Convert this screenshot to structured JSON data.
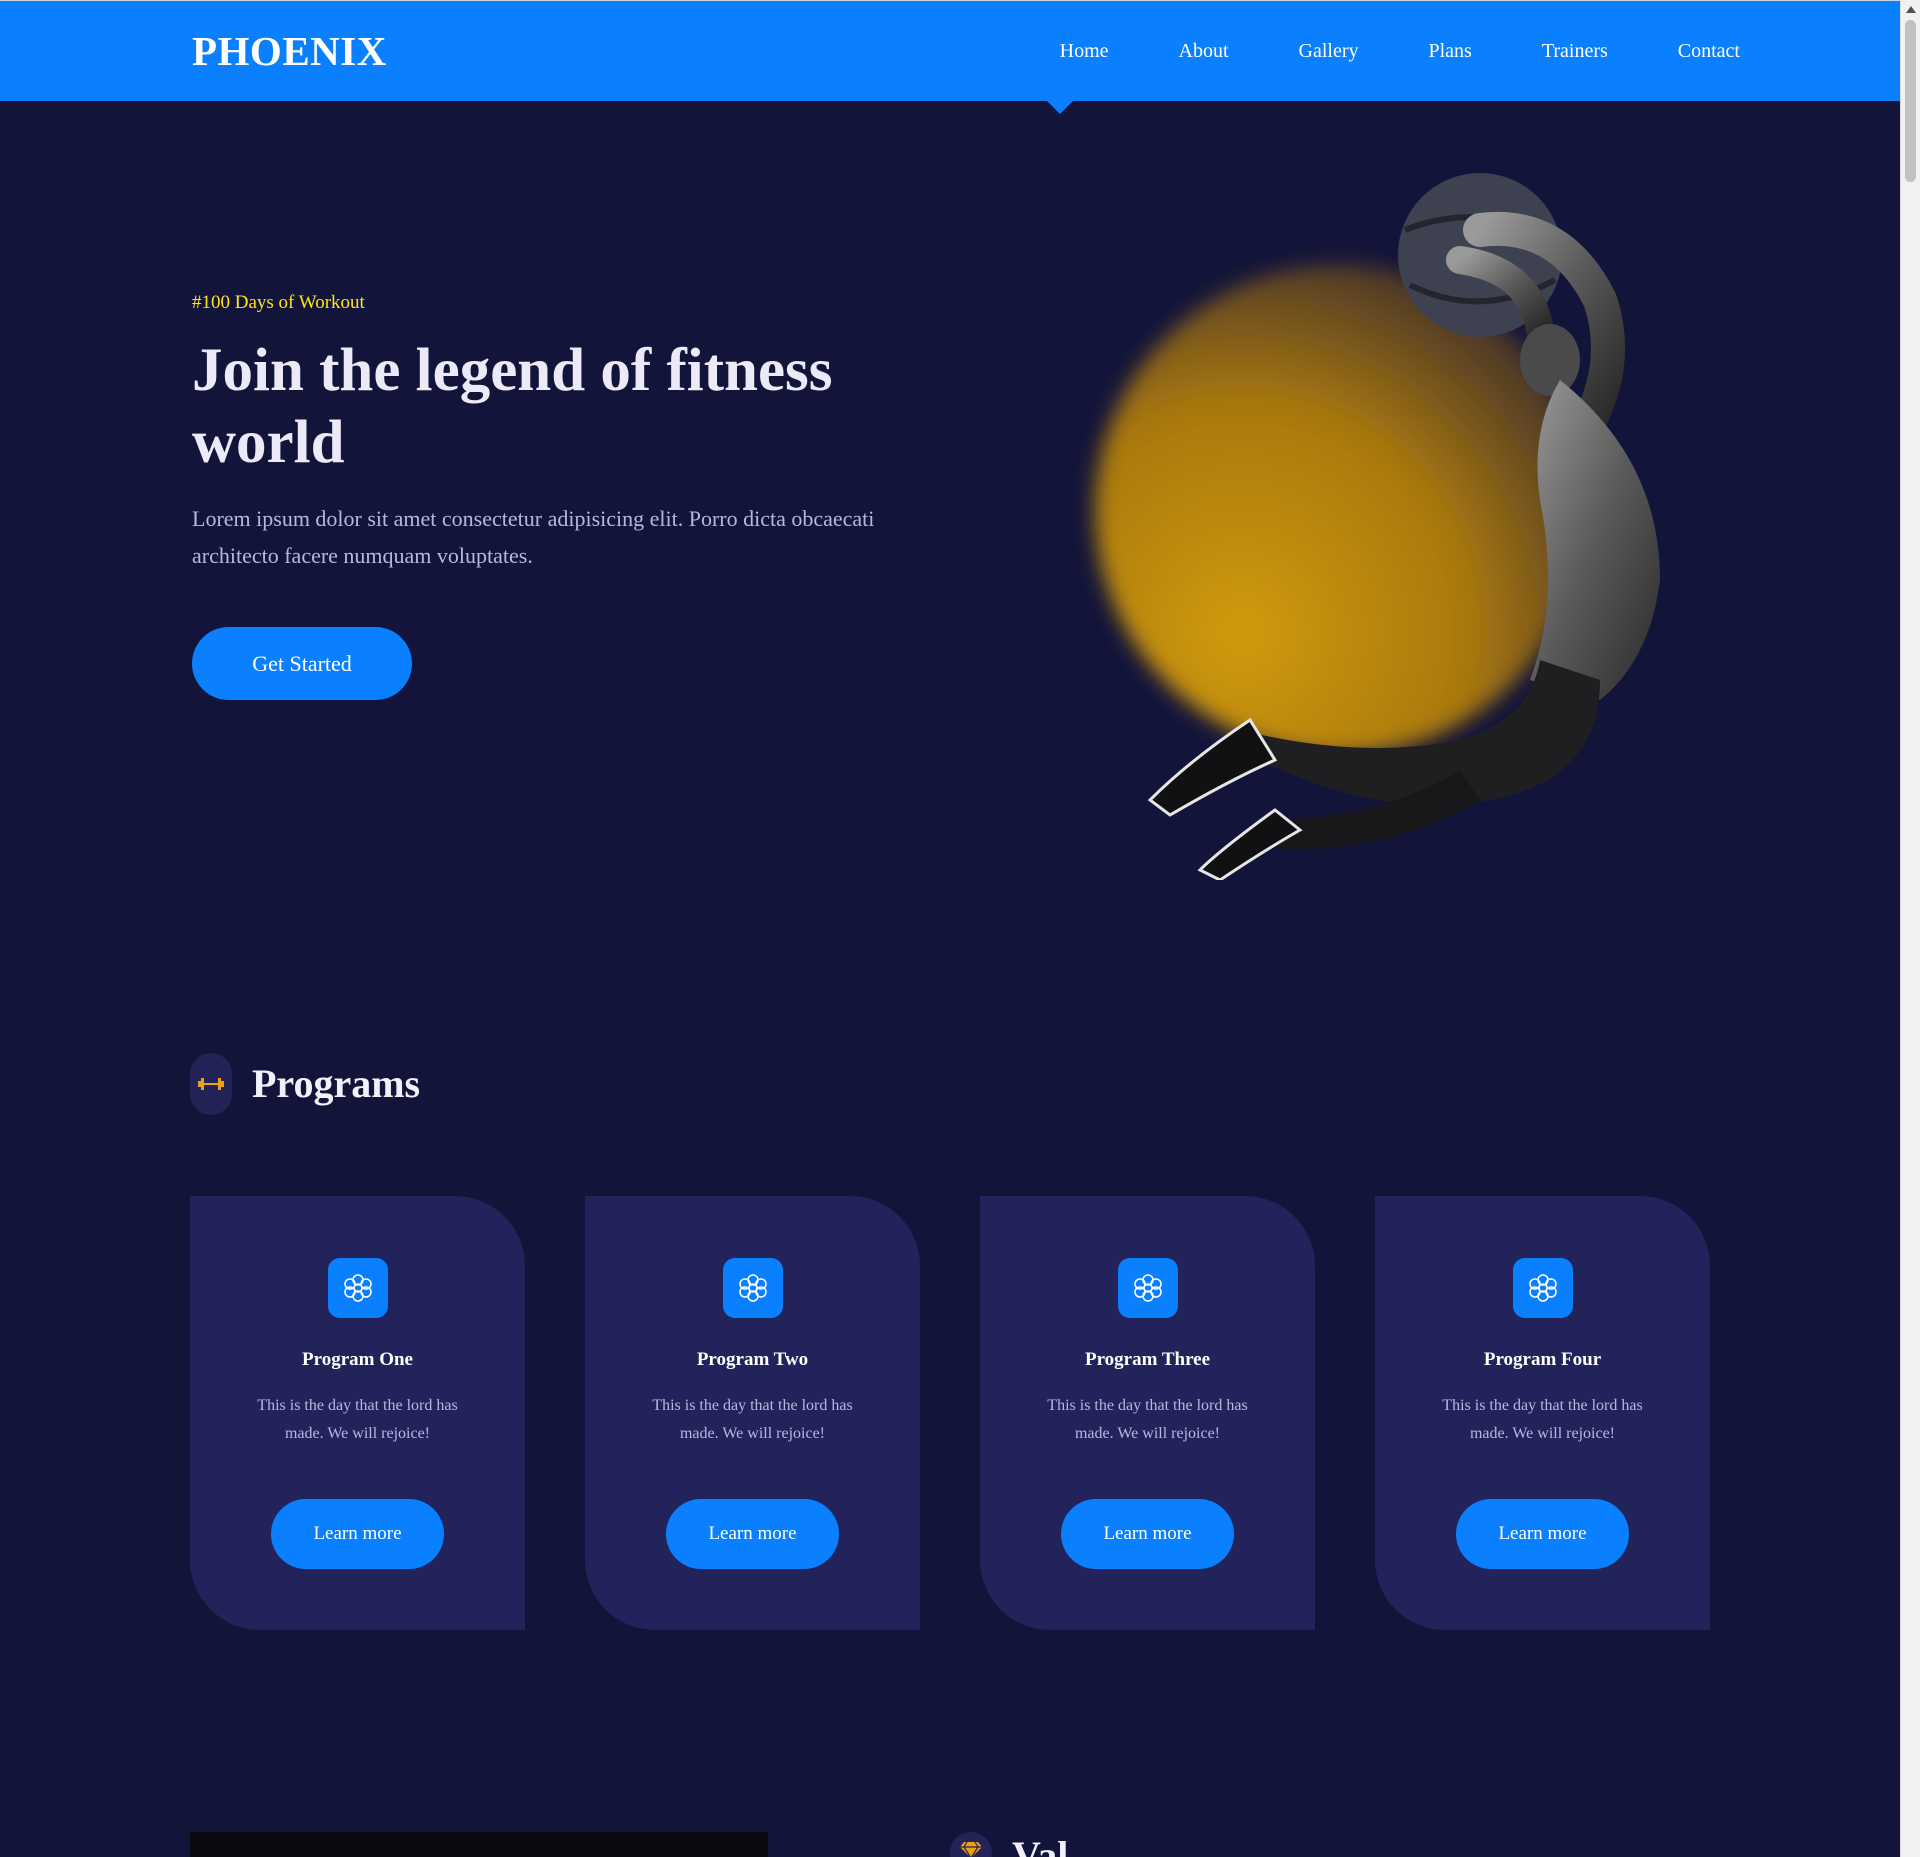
{
  "navbar": {
    "logo": "PHOENIX",
    "links": [
      "Home",
      "About",
      "Gallery",
      "Plans",
      "Trainers",
      "Contact"
    ],
    "active": "Home",
    "color": "#0a80ff"
  },
  "hero": {
    "tag": "#100 Days of Workout",
    "title": "Join the legend of fitness world",
    "text": "Lorem ipsum dolor sit amet consectetur adipisicing elit. Porro dicta obcaecati architecto facere numquam voluptates.",
    "button": "Get Started",
    "image_icon": "athlete-medicine-ball-image",
    "accent": "#d19a0f"
  },
  "programs": {
    "icon": "dumbbell-icon",
    "title": "Programs",
    "cards": [
      {
        "icon": "flower-icon",
        "title": "Program One",
        "text": "This is the day that the lord has made. We will rejoice!",
        "button": "Learn more"
      },
      {
        "icon": "flower-icon",
        "title": "Program Two",
        "text": "This is the day that the lord has made. We will rejoice!",
        "button": "Learn more"
      },
      {
        "icon": "flower-icon",
        "title": "Program Three",
        "text": "This is the day that the lord has made. We will rejoice!",
        "button": "Learn more"
      },
      {
        "icon": "flower-icon",
        "title": "Program Four",
        "text": "This is the day that the lord has made. We will rejoice!",
        "button": "Learn more"
      }
    ]
  },
  "next_section": {
    "icon": "diamond-icon",
    "title": "Val"
  },
  "colors": {
    "background": "#13143a",
    "card": "#22235b",
    "button": "#0a80ff",
    "tag": "#ffe51a"
  }
}
